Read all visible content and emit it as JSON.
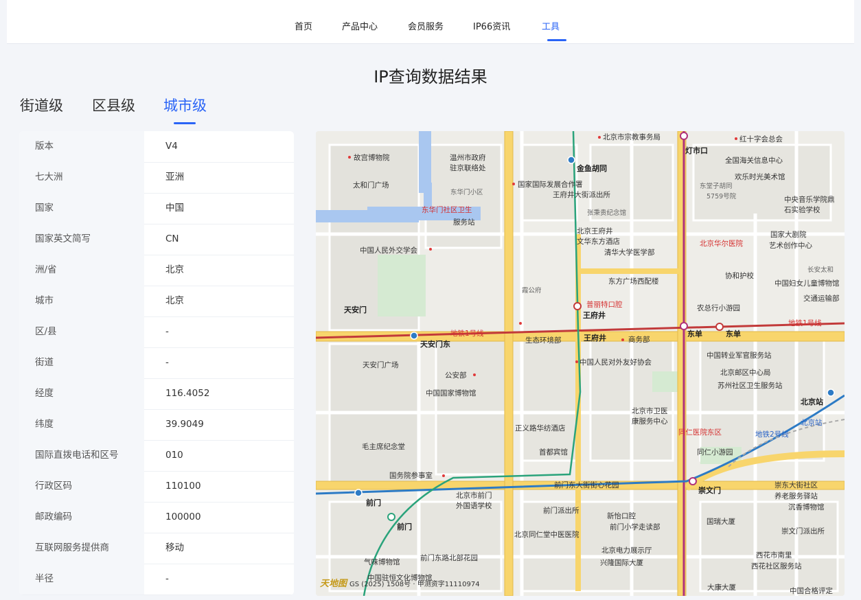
{
  "nav": {
    "items": [
      {
        "label": "首页"
      },
      {
        "label": "产品中心"
      },
      {
        "label": "会员服务"
      },
      {
        "label": "IP66资讯"
      },
      {
        "label": "工具"
      }
    ],
    "active_index": 4
  },
  "page": {
    "title": "IP查询数据结果"
  },
  "tabs": [
    {
      "label": "街道级"
    },
    {
      "label": "区县级"
    },
    {
      "label": "城市级"
    }
  ],
  "active_tab_index": 2,
  "info": {
    "rows": [
      {
        "key": "版本",
        "value": "V4"
      },
      {
        "key": "七大洲",
        "value": "亚洲"
      },
      {
        "key": "国家",
        "value": "中国"
      },
      {
        "key": "国家英文简写",
        "value": "CN"
      },
      {
        "key": "洲/省",
        "value": "北京"
      },
      {
        "key": "城市",
        "value": "北京"
      },
      {
        "key": "区/县",
        "value": "-"
      },
      {
        "key": "街道",
        "value": "-"
      },
      {
        "key": "经度",
        "value": "116.4052"
      },
      {
        "key": "纬度",
        "value": "39.9049"
      },
      {
        "key": "国际直拨电话和区号",
        "value": "010"
      },
      {
        "key": "行政区码",
        "value": "110100"
      },
      {
        "key": "邮政编码",
        "value": "100000"
      },
      {
        "key": "互联网服务提供商",
        "value": "移动"
      },
      {
        "key": "半径",
        "value": "-"
      }
    ]
  },
  "map": {
    "labels": {
      "l1": "北京市宗教事务局",
      "l2": "红十字会总会",
      "l3": "灯市口",
      "l4": "全国海关信息中心",
      "l5": "故宫博物院",
      "l6": "温州市政府",
      "l7": "驻京联络处",
      "l8": "金鱼胡同",
      "l9": "欢乐时光美术馆",
      "l10": "太和门广场",
      "l11": "东华门小区",
      "l12": "国家国际发展合作署",
      "l13": "王府井大街派出所",
      "l14": "东堂子胡同",
      "l15": "5759号院",
      "l16": "中央音乐学院鼎",
      "l17": "石实验学校",
      "l18": "东华门社区卫生",
      "l19": "服务站",
      "l20": "张秉贵纪念馆",
      "l21": "北京王府井",
      "l22": "文华东方酒店",
      "l23": "国家大剧院",
      "l24": "中国人民外交学会",
      "l25": "北京华尔医院",
      "l26": "艺术创作中心",
      "l27": "清华大学医学部",
      "l28": "协和护校",
      "l29": "长安太和",
      "l30": "东方广场西配楼",
      "l31": "中国妇女儿童博物馆",
      "l32": "普丽特口腔",
      "l33": "交通运输部",
      "l34": "天安门",
      "l35": "王府井",
      "l36": "农总行小游园",
      "l37": "地铁1号线",
      "l38": "地铁1号线",
      "l39": "天安门东",
      "l40": "生态环境部",
      "l41": "王府井",
      "l42": "商务部",
      "l43": "东单",
      "l44": "东单",
      "l45": "天安门广场",
      "l46": "中国人民对外友好协会",
      "l47": "中国转业军官服务站",
      "l48": "公安部",
      "l49": "北京邮区中心局",
      "l50": "中国国家博物馆",
      "l51": "苏州社区卫生服务站",
      "l52": "北京站",
      "l53": "北京市卫医",
      "l54": "康服务中心",
      "l55": "北京站",
      "l56": "正义路华纺酒店",
      "l57": "同仁医院东区",
      "l58": "地铁2号线",
      "l59": "毛主席纪念堂",
      "l60": "首都宾馆",
      "l61": "同仁小游园",
      "l62": "国务院参事室",
      "l63": "前门东大街街心花园",
      "l64": "北京市前门",
      "l65": "外国语学校",
      "l66": "崇文门",
      "l67": "崇东大街社区",
      "l68": "养老服务驿站",
      "l69": "前门",
      "l70": "沉香博物馆",
      "l71": "前门派出所",
      "l72": "新怡口腔",
      "l73": "前门小学走读部",
      "l74": "国瑞大厦",
      "l75": "前门",
      "l76": "北京同仁堂中医医院",
      "l77": "崇文门派出所",
      "l78": "前门东路北部花园",
      "l79": "北京电力展示厅",
      "l80": "气味博物馆",
      "l81": "兴隆国际大厦",
      "l82": "西花市南里",
      "l83": "西花社区服务站",
      "l84": "中国驻恒文化博物馆",
      "l85": "大康大厦",
      "l86": "中国合格评定",
      "l87": "霞公府"
    },
    "copyright": "GS (2025) 1508号 · 甲测资字11110974",
    "logo": "天地图"
  }
}
